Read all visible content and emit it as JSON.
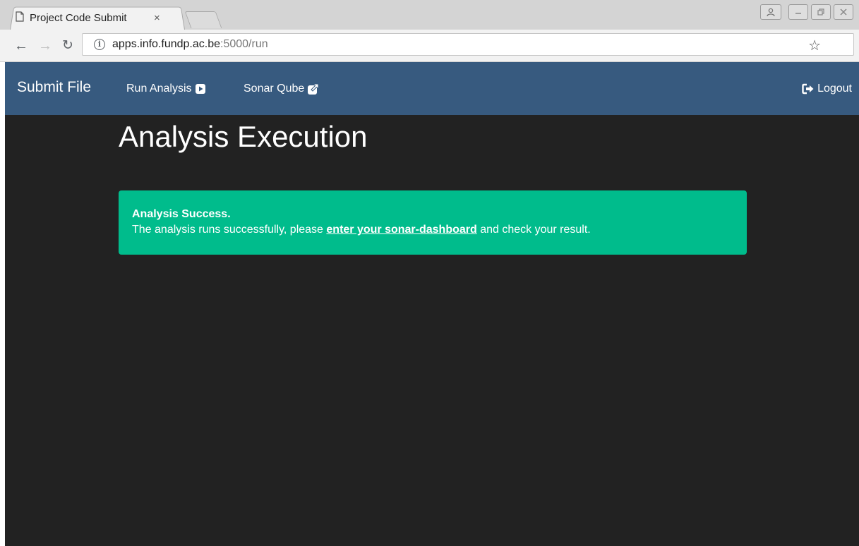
{
  "browser": {
    "tab_title": "Project Code Submit",
    "tab_close": "×",
    "url_host": "apps.info.fundp.ac.be",
    "url_path": ":5000/run",
    "icons": {
      "back": "arrow-left",
      "forward": "arrow-right",
      "reload": "reload",
      "info": "info",
      "bookmark": "star",
      "menu": "vertical-dots"
    }
  },
  "navbar": {
    "brand": "Submit File",
    "run_analysis": "Run Analysis",
    "sonar_qube": "Sonar Qube",
    "logout": "Logout",
    "background_color": "#375a7f"
  },
  "main": {
    "title": "Analysis Execution",
    "alert": {
      "heading": "Analysis Success.",
      "text_before": "The analysis runs successfully, please ",
      "link_text": "enter your sonar-dashboard",
      "text_after": " and check your result.",
      "color": "#00bc8c"
    },
    "background_color": "#222222"
  }
}
